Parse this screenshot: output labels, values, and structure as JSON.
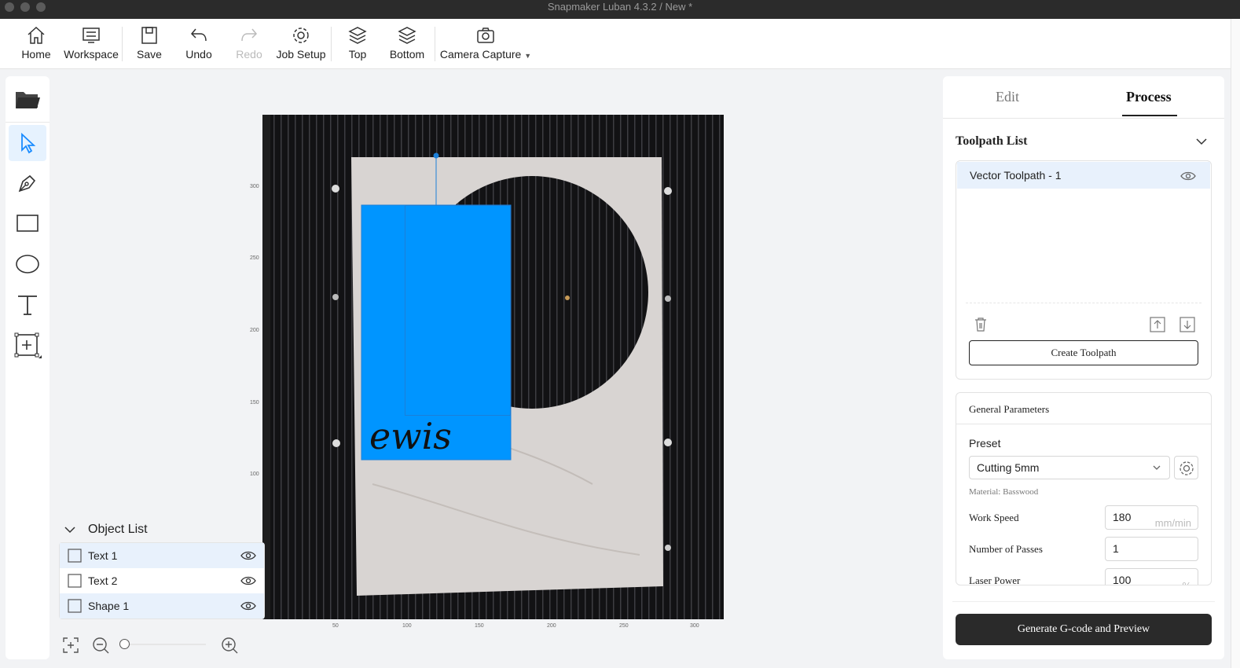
{
  "window": {
    "title": "Snapmaker Luban 4.3.2 / New *"
  },
  "toolbar": {
    "home": "Home",
    "workspace": "Workspace",
    "save": "Save",
    "undo": "Undo",
    "redo": "Redo",
    "job_setup": "Job Setup",
    "top": "Top",
    "bottom": "Bottom",
    "camera_capture": "Camera Capture"
  },
  "left_tools": [
    "folder-icon",
    "select-pointer-icon",
    "pen-icon",
    "rectangle-icon",
    "ellipse-icon",
    "text-icon",
    "insert-frame-icon"
  ],
  "canvas": {
    "text_object": "ewis",
    "ruler_y": [
      "300",
      "250",
      "200",
      "150",
      "100"
    ],
    "ruler_x": [
      "50",
      "100",
      "150",
      "200",
      "250",
      "300"
    ],
    "selection_color": "#0095ff"
  },
  "object_list": {
    "title": "Object List",
    "items": [
      {
        "label": "Text 1",
        "selected": true
      },
      {
        "label": "Text 2",
        "selected": false
      },
      {
        "label": "Shape 1",
        "selected": true
      }
    ]
  },
  "right_panel": {
    "tabs": {
      "edit": "Edit",
      "process": "Process"
    },
    "toolpath_list": {
      "title": "Toolpath List",
      "items": [
        "Vector Toolpath - 1"
      ],
      "create_button": "Create Toolpath"
    },
    "general_parameters": {
      "title": "General Parameters",
      "preset_label": "Preset",
      "preset_value": "Cutting 5mm",
      "material": "Material: Basswood",
      "work_speed_label": "Work Speed",
      "work_speed_value": "180",
      "work_speed_unit": "mm/min",
      "passes_label": "Number of Passes",
      "passes_value": "1",
      "laser_power_label": "Laser Power",
      "laser_power_value": "100",
      "laser_power_unit": "%"
    },
    "generate_button": "Generate G-code and Preview"
  }
}
